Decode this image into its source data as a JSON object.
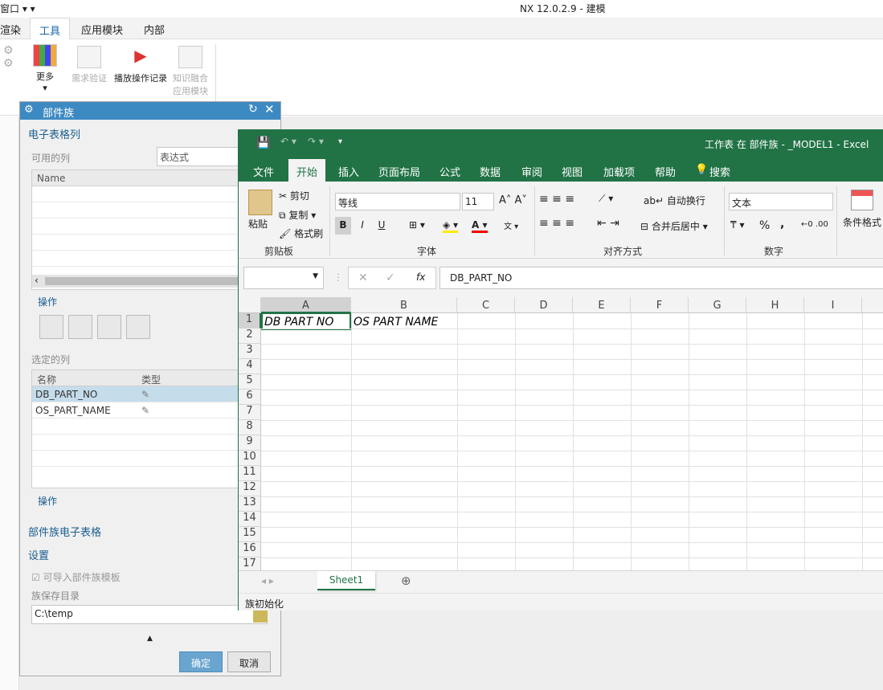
{
  "nx": {
    "title": "NX 12.0.2.9 - 建模",
    "quick": "窗口 ▾ ▾",
    "tabs": [
      "渲染",
      "工具",
      "应用模块",
      "内部"
    ],
    "ribbon": {
      "more": "更多",
      "req": "需求验证",
      "play": "播放操作记录",
      "kf1": "知识融合",
      "kf2": "应用模块"
    }
  },
  "dialog": {
    "title": "部件族",
    "sec_spreadsheet_cols": "电子表格列",
    "available_label": "可用的列",
    "available_dropdown": "表达式",
    "col_name": "Name",
    "ops_label": "操作",
    "selected_label": "选定的列",
    "sel_headers": [
      "名称",
      "类型"
    ],
    "selected_rows": [
      "DB_PART_NO",
      "OS_PART_NAME"
    ],
    "ops2_label": "操作",
    "sec_family_sheet": "部件族电子表格",
    "sec_settings": "设置",
    "import_checkbox": "可导入部件族模板",
    "save_dir_label": "族保存目录",
    "save_dir_value": "C:\\temp",
    "ok": "确定",
    "cancel": "取消"
  },
  "excel": {
    "title": "工作表 在 部件族 - _MODEL1  -  Excel",
    "menu": [
      "文件",
      "开始",
      "插入",
      "页面布局",
      "公式",
      "数据",
      "审阅",
      "视图",
      "加载项",
      "帮助",
      "搜索"
    ],
    "clipboard": {
      "paste": "粘贴",
      "cut": "剪切",
      "copy": "复制",
      "format": "格式刷",
      "group": "剪贴板"
    },
    "font": {
      "name": "等线",
      "size": "11",
      "group": "字体",
      "bold": "B",
      "italic": "I",
      "underline": "U"
    },
    "align": {
      "wrap": "自动换行",
      "merge": "合并后居中",
      "group": "对齐方式"
    },
    "number": {
      "format": "文本",
      "group": "数字",
      "pct": "%",
      "comma": ","
    },
    "cond": "条件格式",
    "formula_value": "DB_PART_NO",
    "fx": "fx",
    "columns": [
      "A",
      "B",
      "C",
      "D",
      "E",
      "F",
      "G",
      "H",
      "I"
    ],
    "rows": [
      "1",
      "2",
      "3",
      "4",
      "5",
      "6",
      "7",
      "8",
      "9",
      "10",
      "11",
      "12",
      "13",
      "14",
      "15",
      "16",
      "17"
    ],
    "cell_a1": "DB PART NO",
    "cell_b1": "OS PART NAME",
    "sheet": "Sheet1",
    "status": "族初始化"
  }
}
